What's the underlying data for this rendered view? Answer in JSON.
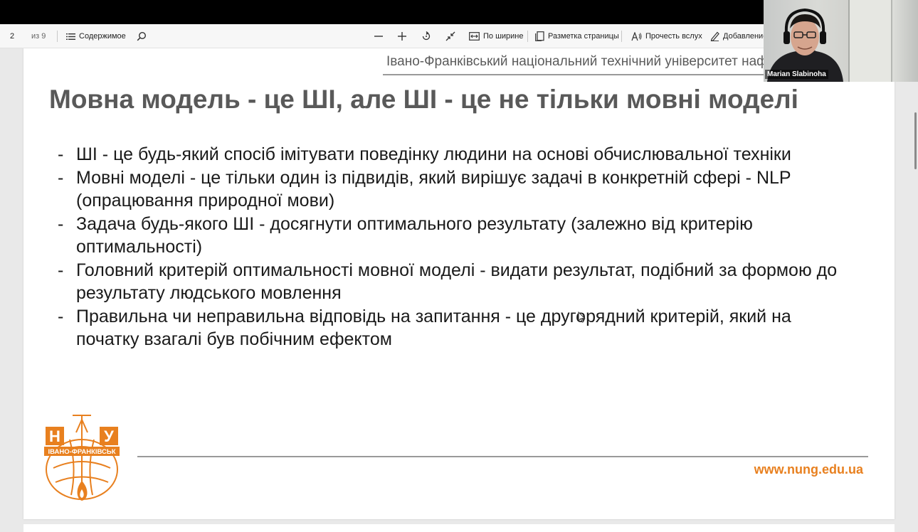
{
  "toolbar": {
    "page_current": "2",
    "page_total": "из 9",
    "contents_label": "Содержимое",
    "fit_width_label": "По ширине",
    "page_layout_label": "Разметка страницы",
    "read_aloud_label": "Прочесть вслух",
    "add_notes_label": "Добавление"
  },
  "slide": {
    "university": "Івано-Франківський національний технічний університет нафти і газу",
    "title": "Мовна модель - це ШІ, але ШІ - це не тільки мовні моделі",
    "bullets": [
      "ШІ - це будь-який спосіб імітувати поведінку людини на основі обчислювальної техніки",
      "Мовні моделі - це тільки один із підвидів, який вирішує задачі в конкретній сфері - NLP (опрацювання природної мови)",
      "Задача будь-якого ШІ - досягнути оптимального результату (залежно від критерію оптимальності)",
      "Головний критерій оптимальності мовної моделі - видати результат, подібний за формою до результату людського мовлення",
      "Правильна чи неправильна відповідь на запитання - це другорядний критерій, який на початку взагалі був побічним ефектом"
    ],
    "bullet_marker": "-",
    "logo_text_top": "Н",
    "logo_text_right": "У",
    "logo_city": "ІВАНО-ФРАНКІВСЬК",
    "website": "www.nung.edu.ua"
  },
  "video": {
    "participant_name": "Marian Slabinoha"
  },
  "colors": {
    "accent_orange": "#e8801f",
    "title_gray": "#595959"
  }
}
